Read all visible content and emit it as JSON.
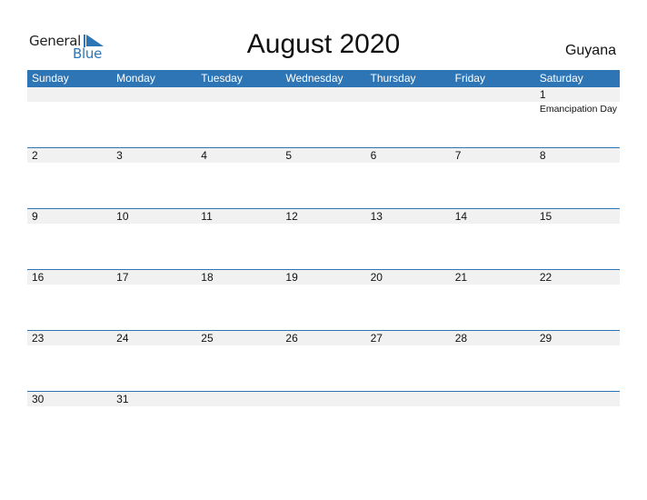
{
  "logo": {
    "line1": "General",
    "line2": "Blue",
    "icon": "triangle-flag-icon",
    "accent": "#2e75b6"
  },
  "title": "August 2020",
  "country": "Guyana",
  "colors": {
    "header_bg": "#2e75b6",
    "band_bg": "#f1f1f1"
  },
  "weekdays": [
    "Sunday",
    "Monday",
    "Tuesday",
    "Wednesday",
    "Thursday",
    "Friday",
    "Saturday"
  ],
  "weeks": [
    [
      {
        "day": ""
      },
      {
        "day": ""
      },
      {
        "day": ""
      },
      {
        "day": ""
      },
      {
        "day": ""
      },
      {
        "day": ""
      },
      {
        "day": "1",
        "holiday": "Emancipation Day"
      }
    ],
    [
      {
        "day": "2"
      },
      {
        "day": "3"
      },
      {
        "day": "4"
      },
      {
        "day": "5"
      },
      {
        "day": "6"
      },
      {
        "day": "7"
      },
      {
        "day": "8"
      }
    ],
    [
      {
        "day": "9"
      },
      {
        "day": "10"
      },
      {
        "day": "11"
      },
      {
        "day": "12"
      },
      {
        "day": "13"
      },
      {
        "day": "14"
      },
      {
        "day": "15"
      }
    ],
    [
      {
        "day": "16"
      },
      {
        "day": "17"
      },
      {
        "day": "18"
      },
      {
        "day": "19"
      },
      {
        "day": "20"
      },
      {
        "day": "21"
      },
      {
        "day": "22"
      }
    ],
    [
      {
        "day": "23"
      },
      {
        "day": "24"
      },
      {
        "day": "25"
      },
      {
        "day": "26"
      },
      {
        "day": "27"
      },
      {
        "day": "28"
      },
      {
        "day": "29"
      }
    ],
    [
      {
        "day": "30"
      },
      {
        "day": "31"
      },
      {
        "day": ""
      },
      {
        "day": ""
      },
      {
        "day": ""
      },
      {
        "day": ""
      },
      {
        "day": ""
      }
    ]
  ]
}
